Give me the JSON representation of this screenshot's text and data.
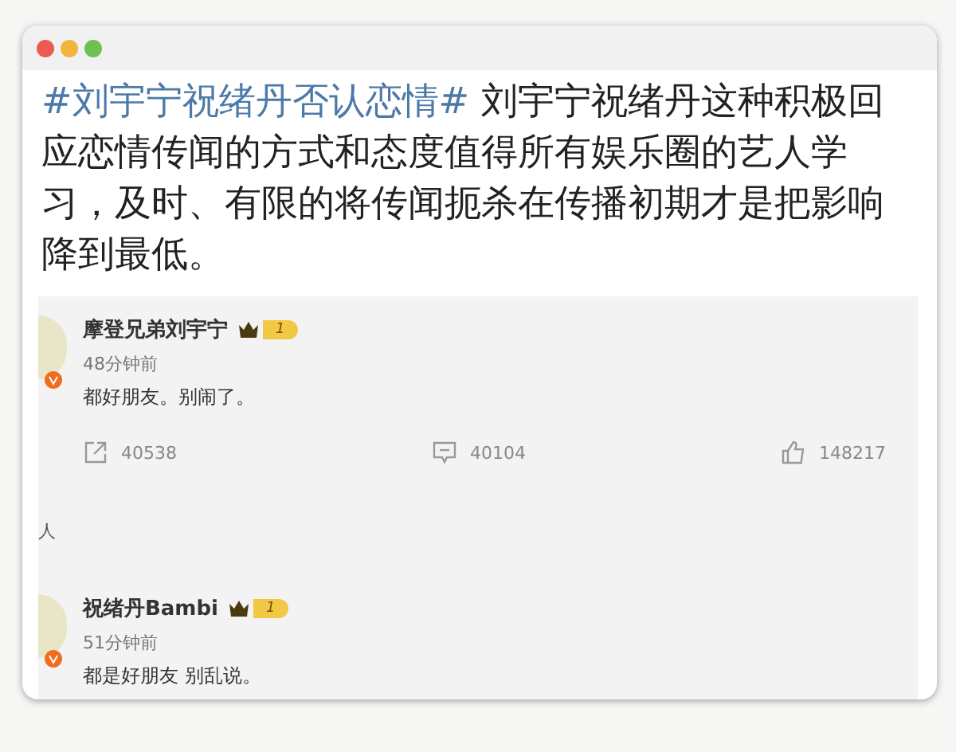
{
  "post": {
    "hashtag": "#刘宇宁祝绪丹否认恋情#",
    "text": " 刘宇宁祝绪丹这种积极回应恋情传闻的方式和态度值得所有娱乐圈的艺人学习，及时、有限的将传闻扼杀在传播初期才是把影响降到最低。"
  },
  "comments": [
    {
      "name": "摩登兄弟刘宇宁",
      "badge": "1",
      "verified": true,
      "time": "48分钟前",
      "text": "都好朋友。别闹了。",
      "actions": [
        {
          "kind": "share",
          "count": "40538"
        },
        {
          "kind": "comment",
          "count": "40104"
        },
        {
          "kind": "like",
          "count": "148217"
        }
      ]
    },
    {
      "name": "祝绪丹Bambi",
      "badge": "1",
      "verified": true,
      "time": "51分钟前",
      "text": "都是好朋友 别乱说。"
    }
  ],
  "divider_label": "人"
}
